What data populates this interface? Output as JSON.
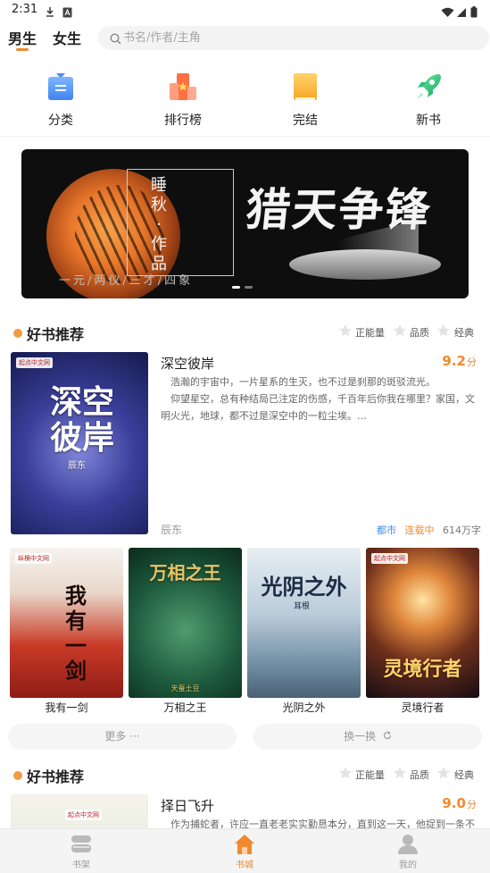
{
  "status_bar": {
    "time": "2:31"
  },
  "top": {
    "gender_tabs": [
      "男生",
      "女生"
    ],
    "active_gender": "男生",
    "search_placeholder": "书名/作者/主角"
  },
  "quick_nav": [
    {
      "label": "分类",
      "icon": "category-icon"
    },
    {
      "label": "排行榜",
      "icon": "ranking-icon"
    },
    {
      "label": "完结",
      "icon": "completed-book-icon"
    },
    {
      "label": "新书",
      "icon": "rocket-icon"
    }
  ],
  "banner": {
    "author_line": "睡秋·作品",
    "subtitle": "一元/两仪/三才/四象",
    "title": "猎天争锋",
    "page_count": 2,
    "active_page": 1
  },
  "sections": [
    {
      "title": "好书推荐",
      "tags": [
        "正能量",
        "品质",
        "经典"
      ],
      "featured": {
        "title": "深空彼岸",
        "score": "9.2",
        "score_unit": "分",
        "cover_text": "深空彼岸",
        "cover_author": "辰东",
        "cover_badge": "起点中文网",
        "description": "浩瀚的宇宙中，一片星系的生灭，也不过是刹那的斑驳流光。",
        "description2": "仰望星空，总有种结局已注定的伤感，千百年后你我在哪里？家国，文明火光，地球，都不过是深空中的一粒尘埃。…",
        "author": "辰东",
        "category": "都市",
        "status": "连载中",
        "word_count": "614万字"
      },
      "grid": [
        {
          "title": "我有一剑",
          "cover_text": "我有一剑",
          "cover_badge": "纵横中文网"
        },
        {
          "title": "万相之王",
          "cover_text": "万相之王",
          "cover_badge": "天蚕土豆"
        },
        {
          "title": "光阴之外",
          "cover_text": "光阴之外",
          "cover_badge": "耳根"
        },
        {
          "title": "灵境行者",
          "cover_text": "灵境行者",
          "cover_badge": "起点中文网"
        }
      ],
      "more_label": "更多 ···",
      "refresh_label": "换一换"
    },
    {
      "title": "好书推荐",
      "tags": [
        "正能量",
        "品质",
        "经典"
      ],
      "featured": {
        "title": "择日飞升",
        "score": "9.0",
        "score_unit": "分",
        "cover_badge": "起点中文网",
        "description": "作为捕蛇者，许应一直老老实实勤恳本分，直到这一天，他捉到一条不"
      }
    }
  ],
  "bottom_tabs": [
    {
      "label": "书架",
      "icon": "bookshelf-icon"
    },
    {
      "label": "书城",
      "icon": "home-icon"
    },
    {
      "label": "我的",
      "icon": "profile-icon"
    }
  ],
  "active_tab": "书城",
  "colors": {
    "accent": "#f08a2e",
    "category": "#3b8ee6",
    "status": "#f08a2e",
    "tab_bg": "#f4f4f4"
  }
}
